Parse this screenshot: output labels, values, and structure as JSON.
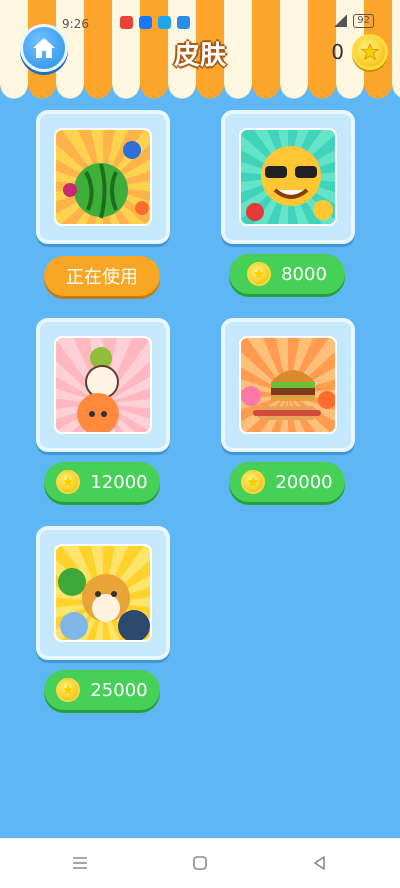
{
  "status_bar": {
    "time": "9:26",
    "battery": "92"
  },
  "header": {
    "title": "皮肤",
    "home_icon": "home-icon",
    "coin_count": "0",
    "coin_icon": "coin-icon"
  },
  "skins": [
    {
      "art": "watermelon-fruit-art",
      "button_label": "正在使用",
      "state": "in_use"
    },
    {
      "art": "emoji-faces-art",
      "price": "8000",
      "state": "locked"
    },
    {
      "art": "stacked-animals-art",
      "price": "12000",
      "state": "locked"
    },
    {
      "art": "burger-hotdog-food-art",
      "price": "20000",
      "state": "locked"
    },
    {
      "art": "shiba-dogs-art",
      "price": "25000",
      "state": "locked"
    }
  ],
  "nav_bar": {
    "menu_icon": "menu-icon",
    "home_icon": "square-home-icon",
    "back_icon": "back-triangle-icon"
  },
  "colors": {
    "background": "#5fb6f5",
    "awning_orange": "#fba62b",
    "awning_cream": "#fff7e0",
    "in_use_button": "#f7a625",
    "price_button": "#46d058",
    "coin": "#f0b800"
  }
}
